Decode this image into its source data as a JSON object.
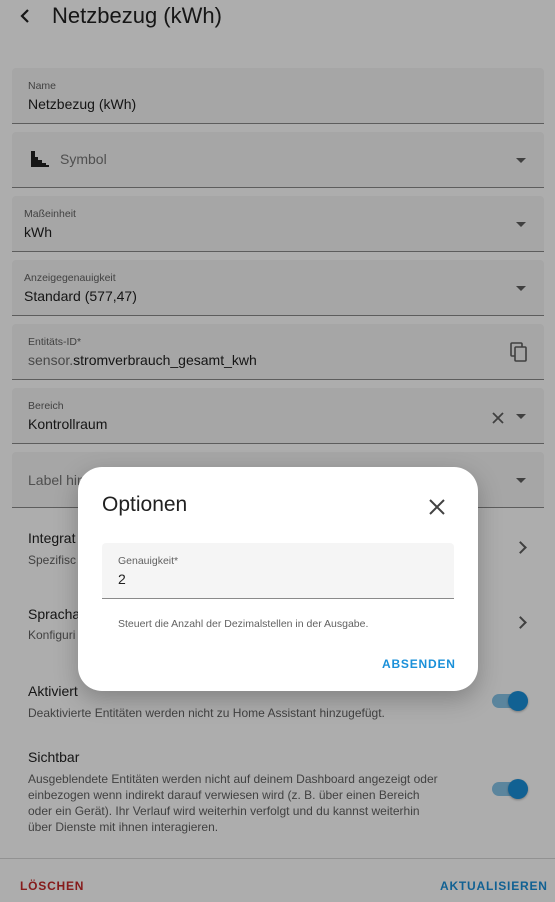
{
  "header": {
    "title": "Netzbezug (kWh)"
  },
  "fields": {
    "name": {
      "label": "Name",
      "value": "Netzbezug (kWh)"
    },
    "symbol": {
      "placeholder": "Symbol"
    },
    "unit": {
      "label": "Maßeinheit",
      "value": "kWh"
    },
    "precision": {
      "label": "Anzeigegenauigkeit",
      "value": "Standard (577,47)"
    },
    "entity_id": {
      "label": "Entitäts-ID*",
      "prefix": "sensor.",
      "value": "stromverbrauch_gesamt_kwh"
    },
    "area": {
      "label": "Bereich",
      "value": "Kontrollraum"
    },
    "labels": {
      "placeholder": "Label hin"
    }
  },
  "rows": {
    "integration": {
      "title": "Integrat",
      "subtitle": "Spezifisc"
    },
    "voice": {
      "title": "Spracha",
      "subtitle": "Konfiguri"
    }
  },
  "toggles": {
    "enabled": {
      "title": "Aktiviert",
      "description": "Deaktivierte Entitäten werden nicht zu Home Assistant hinzugefügt.",
      "on": true
    },
    "visible": {
      "title": "Sichtbar",
      "description_lines": [
        "Ausgeblendete Entitäten werden nicht auf deinem Dashboard angezeigt oder",
        "einbezogen wenn indirekt darauf verwiesen wird (z. B. über einen Bereich",
        "oder ein Gerät). Ihr Verlauf wird weiterhin verfolgt und du kannst weiterhin",
        "über Dienste mit ihnen interagieren."
      ],
      "on": true
    }
  },
  "footer": {
    "delete_label": "LÖSCHEN",
    "update_label": "AKTUALISIEREN"
  },
  "dialog": {
    "title": "Optionen",
    "field_label": "Genauigkeit*",
    "field_value": "2",
    "helper": "Steuert die Anzahl der Dezimalstellen in der Ausgabe.",
    "submit_label": "ABSENDEN"
  },
  "colors": {
    "accent": "#1a90d9",
    "danger": "#c62828",
    "scrim": "#000000"
  }
}
